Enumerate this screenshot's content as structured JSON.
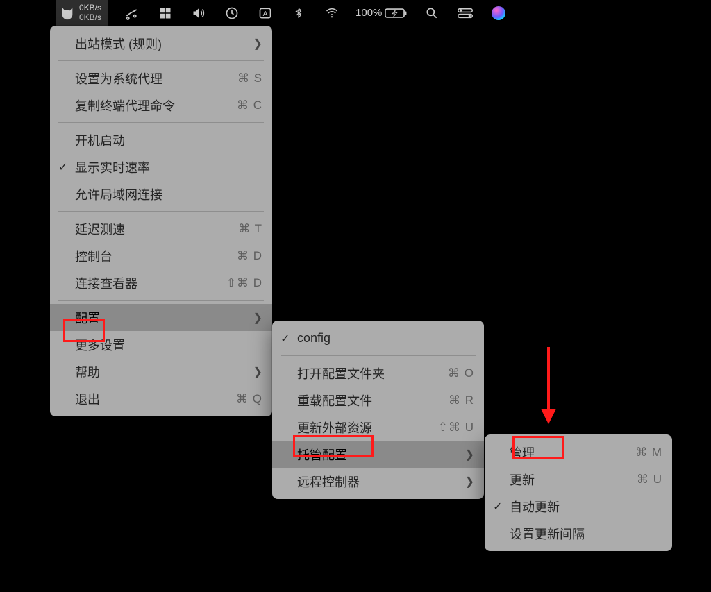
{
  "menubar": {
    "speed_up": "0KB/s",
    "speed_down": "0KB/s",
    "battery": "100%"
  },
  "menu1": {
    "outbound": "出站模式 (规则)",
    "set_proxy": "设置为系统代理",
    "set_proxy_sc": "⌘ S",
    "copy_cmd": "复制终端代理命令",
    "copy_cmd_sc": "⌘ C",
    "startup": "开机启动",
    "show_speed": "显示实时速率",
    "allow_lan": "允许局域网连接",
    "latency": "延迟测速",
    "latency_sc": "⌘ T",
    "console": "控制台",
    "console_sc": "⌘ D",
    "conn": "连接查看器",
    "conn_sc": "⇧⌘ D",
    "config": "配置",
    "more": "更多设置",
    "help": "帮助",
    "quit": "退出",
    "quit_sc": "⌘ Q"
  },
  "menu2": {
    "config": "config",
    "open_folder": "打开配置文件夹",
    "open_folder_sc": "⌘ O",
    "reload": "重载配置文件",
    "reload_sc": "⌘ R",
    "update_ext": "更新外部资源",
    "update_ext_sc": "⇧⌘ U",
    "managed": "托管配置",
    "remote": "远程控制器"
  },
  "menu3": {
    "manage": "管理",
    "manage_sc": "⌘ M",
    "update": "更新",
    "update_sc": "⌘ U",
    "auto": "自动更新",
    "interval": "设置更新间隔"
  }
}
